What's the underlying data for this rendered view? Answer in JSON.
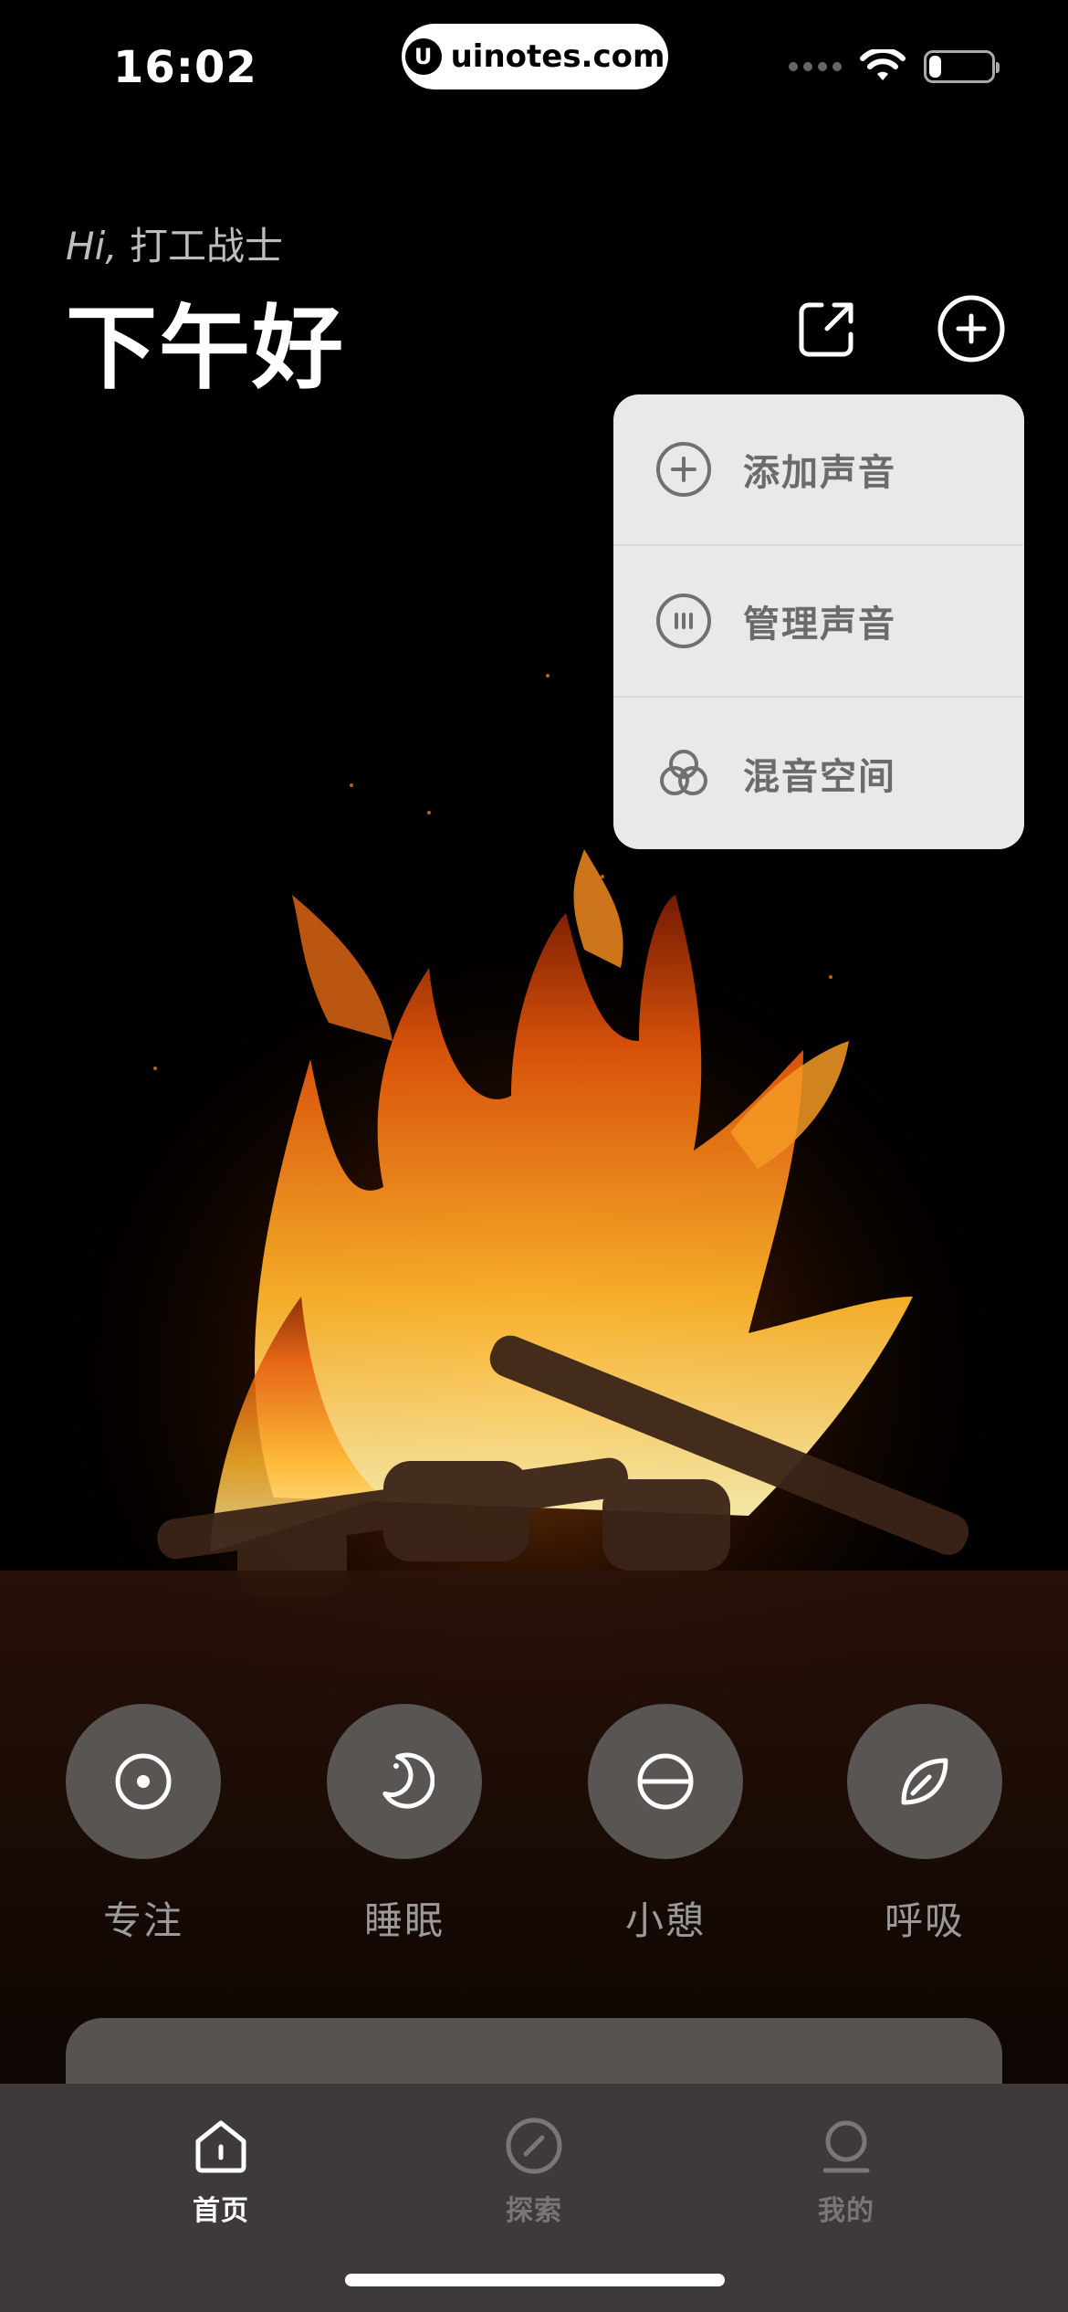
{
  "status_bar": {
    "time": "16:02",
    "url": "uinotes.com",
    "battery_level": 0.2
  },
  "header": {
    "hi": "Hi,",
    "username": "打工战士",
    "greeting": "下午好",
    "share_icon": "share-icon",
    "add_icon": "add-circle-icon"
  },
  "menu": {
    "items": [
      {
        "label": "添加声音",
        "icon": "add-circle-icon"
      },
      {
        "label": "管理声音",
        "icon": "manage-icon"
      },
      {
        "label": "混音空间",
        "icon": "mix-icon"
      }
    ]
  },
  "modes": [
    {
      "label": "专注",
      "icon": "focus-icon"
    },
    {
      "label": "睡眠",
      "icon": "moon-icon"
    },
    {
      "label": "小憩",
      "icon": "nap-icon"
    },
    {
      "label": "呼吸",
      "icon": "leaf-icon"
    }
  ],
  "tabbar": {
    "tabs": [
      {
        "label": "首页",
        "icon": "home-icon",
        "active": true
      },
      {
        "label": "探索",
        "icon": "compass-icon",
        "active": false
      },
      {
        "label": "我的",
        "icon": "profile-icon",
        "active": false
      }
    ]
  },
  "colors": {
    "background": "#000000",
    "menu_bg": "#e9e9e9",
    "menu_text": "#6b6b6b",
    "mode_circle": "#5f5d5c",
    "tabbar_bg": "#3d3a39",
    "tab_active": "#ffffff",
    "tab_inactive": "#7a7675"
  }
}
